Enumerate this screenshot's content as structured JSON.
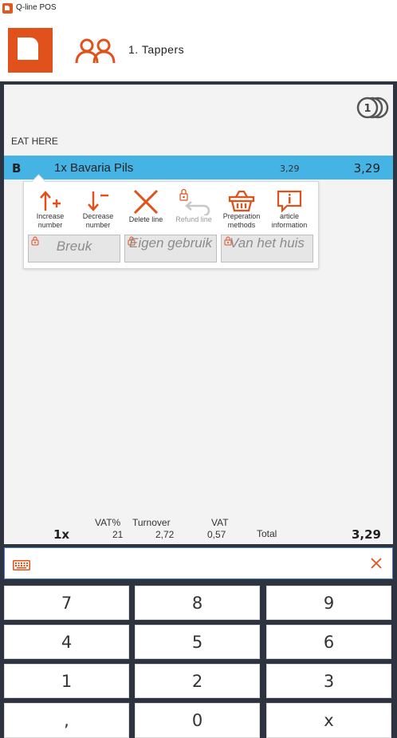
{
  "window": {
    "title": "Q-line POS"
  },
  "header": {
    "table_label": "1. Tappers"
  },
  "order": {
    "section_label": "EAT HERE",
    "lines": [
      {
        "course": "B",
        "description": "1x Bavaria Pils",
        "unit_price": "3,29",
        "total": "3,29"
      }
    ]
  },
  "line_actions": {
    "buttons": [
      {
        "label": "Increase number",
        "enabled": true,
        "icon": "increase-icon"
      },
      {
        "label": "Decrease number",
        "enabled": true,
        "icon": "decrease-icon"
      },
      {
        "label": "Delete line",
        "enabled": true,
        "icon": "delete-icon"
      },
      {
        "label": "Refund line",
        "enabled": false,
        "icon": "refund-icon"
      },
      {
        "label": "Preperation methods",
        "enabled": true,
        "icon": "basket-icon"
      },
      {
        "label": "article information",
        "enabled": true,
        "icon": "info-icon"
      }
    ],
    "options": [
      {
        "label": "Breuk"
      },
      {
        "label": "Eigen gebruik"
      },
      {
        "label": "Van het huis"
      }
    ]
  },
  "totals": {
    "count": "1x",
    "vat_pct_label": "VAT%",
    "vat_pct": "21",
    "turnover_label": "Turnover",
    "turnover": "2,72",
    "vat_label": "VAT",
    "vat": "0,57",
    "total_label": "Total",
    "total": "3,29"
  },
  "keypad": {
    "keys": [
      "7",
      "8",
      "9",
      "4",
      "5",
      "6",
      "1",
      "2",
      "3",
      ",",
      "0",
      "x"
    ]
  },
  "colors": {
    "accent": "#e0511b",
    "selection": "#46b3e5",
    "background": "#2d3440",
    "panel": "#f3f3f3"
  }
}
